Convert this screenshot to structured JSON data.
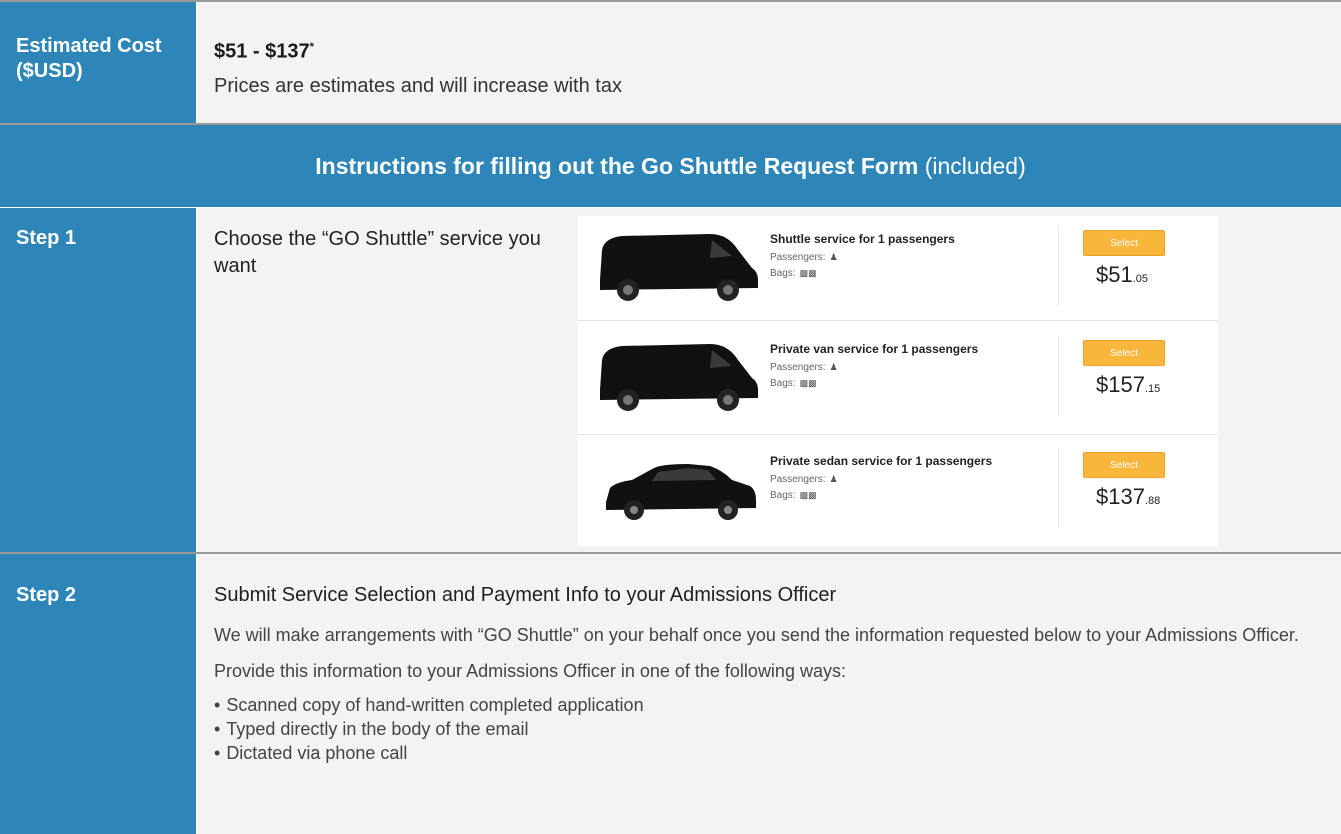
{
  "cost": {
    "label": "Estimated Cost ($USD)",
    "range": "$51 - $137",
    "asterisk": "*",
    "note": "Prices are estimates and will increase with tax"
  },
  "banner": {
    "bold": "Instructions for filling out the Go Shuttle Request Form",
    "normal": "(included)"
  },
  "step1": {
    "label": "Step 1",
    "text": "Choose the “GO Shuttle” service you want",
    "options": [
      {
        "title": "Shuttle service for 1 passengers",
        "passengers_label": "Passengers:",
        "bags_label": "Bags:",
        "button": "Select",
        "price_main": "$51",
        "price_cents": ".05",
        "vehicle": "van"
      },
      {
        "title": "Private van service for 1 passengers",
        "passengers_label": "Passengers:",
        "bags_label": "Bags:",
        "button": "Select",
        "price_main": "$157",
        "price_cents": ".15",
        "vehicle": "van"
      },
      {
        "title": "Private sedan service for 1 passengers",
        "passengers_label": "Passengers:",
        "bags_label": "Bags:",
        "button": "Select",
        "price_main": "$137",
        "price_cents": ".88",
        "vehicle": "sedan"
      }
    ]
  },
  "step2": {
    "label": "Step 2",
    "title": "Submit Service Selection and Payment Info to your Admissions Officer",
    "para1": "We will make arrangements with “GO Shuttle” on your behalf once you send the information requested below to your Admissions Officer.",
    "para2": "Provide this information to your Admissions Officer in one of the following ways:",
    "bullets": [
      "Scanned copy of hand-written completed application",
      "Typed directly in the body of the email",
      "Dictated via phone call"
    ]
  },
  "colors": {
    "accent": "#2e86b8",
    "content_bg": "#f3f3f3",
    "select_button": "#f8b63a"
  }
}
